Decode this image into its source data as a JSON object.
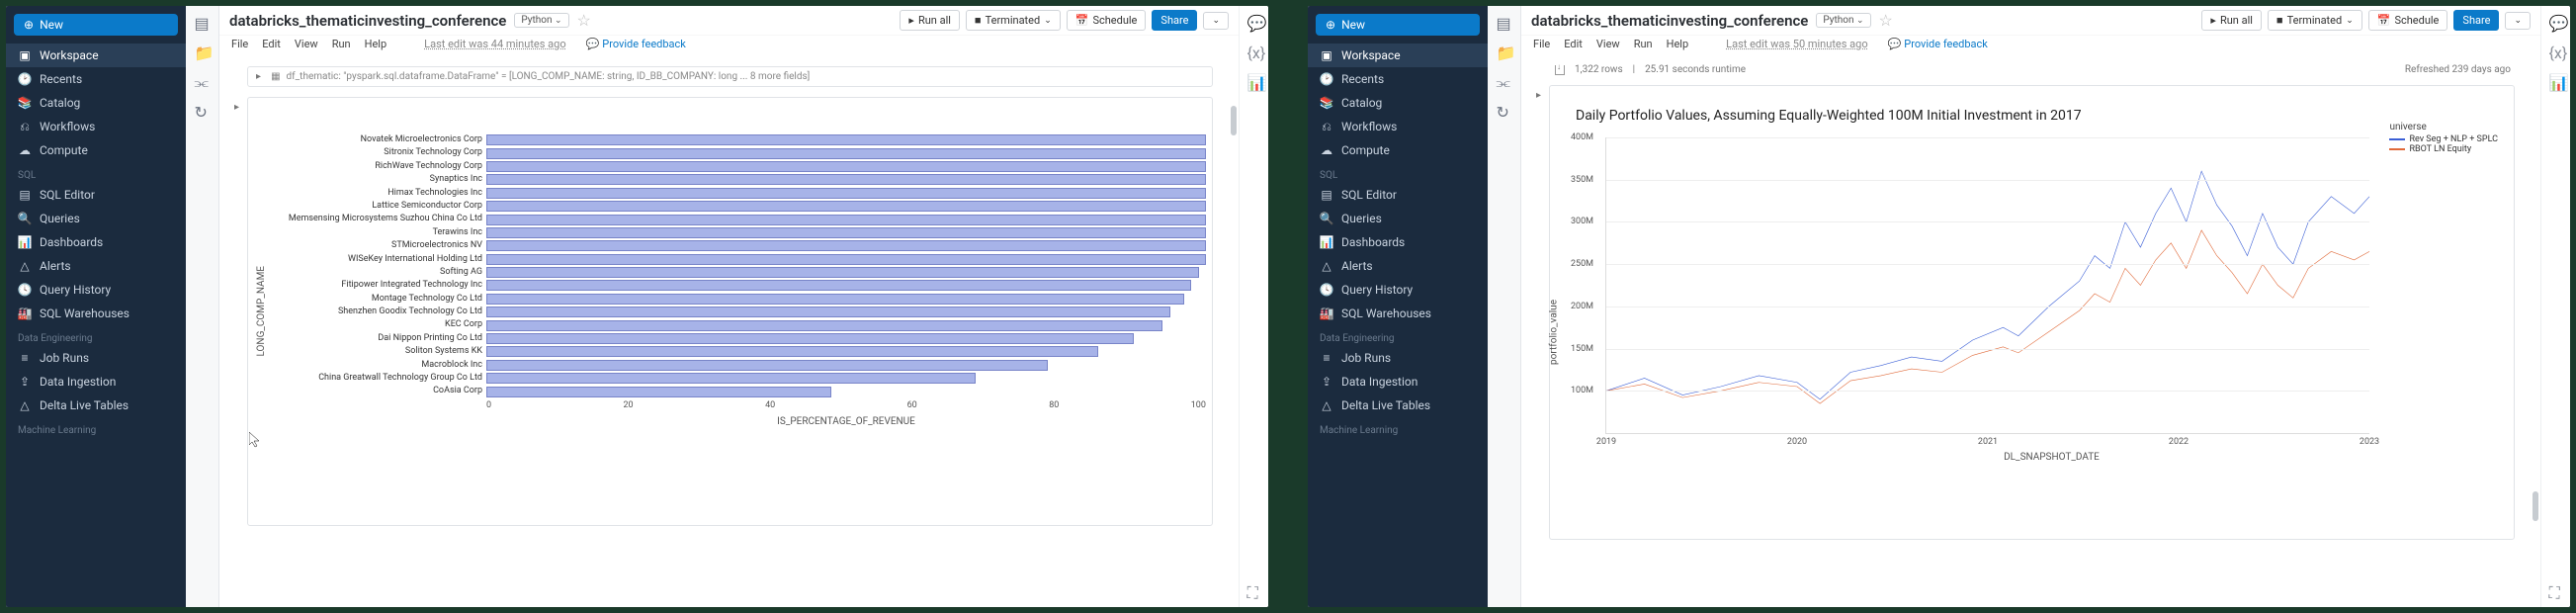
{
  "sidebar": {
    "new_label": "New",
    "items_main": [
      {
        "icon": "workspace",
        "label": "Workspace",
        "active": true
      },
      {
        "icon": "recents",
        "label": "Recents"
      },
      {
        "icon": "catalog",
        "label": "Catalog"
      },
      {
        "icon": "workflows",
        "label": "Workflows"
      },
      {
        "icon": "compute",
        "label": "Compute"
      }
    ],
    "section_sql": "SQL",
    "items_sql": [
      {
        "icon": "sqleditor",
        "label": "SQL Editor"
      },
      {
        "icon": "queries",
        "label": "Queries"
      },
      {
        "icon": "dashboards",
        "label": "Dashboards"
      },
      {
        "icon": "alerts",
        "label": "Alerts"
      },
      {
        "icon": "queryhistory",
        "label": "Query History"
      },
      {
        "icon": "warehouses",
        "label": "SQL Warehouses"
      }
    ],
    "section_de": "Data Engineering",
    "items_de": [
      {
        "icon": "jobruns",
        "label": "Job Runs"
      },
      {
        "icon": "ingestion",
        "label": "Data Ingestion"
      },
      {
        "icon": "dlt",
        "label": "Delta Live Tables"
      }
    ],
    "section_ml": "Machine Learning"
  },
  "notebook_left": {
    "title": "databricks_thematicinvesting_conference",
    "language": "Python",
    "menus": [
      "File",
      "Edit",
      "View",
      "Run",
      "Help"
    ],
    "last_edit": "Last edit was 44 minutes ago",
    "feedback": "Provide feedback",
    "run_all": "Run all",
    "status": "Terminated",
    "schedule": "Schedule",
    "share": "Share",
    "cell_stub": "df_thematic: \"pyspark.sql.dataframe.DataFrame\" = [LONG_COMP_NAME: string, ID_BB_COMPANY: long ... 8 more fields]"
  },
  "notebook_right": {
    "title": "databricks_thematicinvesting_conference",
    "language": "Python",
    "menus": [
      "File",
      "Edit",
      "View",
      "Run",
      "Help"
    ],
    "last_edit": "Last edit was 50 minutes ago",
    "feedback": "Provide feedback",
    "run_all": "Run all",
    "status": "Terminated",
    "schedule": "Schedule",
    "share": "Share",
    "status_rows": "1,322 rows",
    "status_runtime": "25.91 seconds runtime",
    "status_refreshed": "Refreshed 239 days ago"
  },
  "chart_data": [
    {
      "type": "bar",
      "orientation": "horizontal",
      "xlabel": "IS_PERCENTAGE_OF_REVENUE",
      "ylabel": "LONG_COMP_NAME",
      "xlim": [
        0,
        100
      ],
      "xticks": [
        0,
        20,
        40,
        60,
        80,
        100
      ],
      "categories": [
        "Novatek Microelectronics Corp",
        "Sitronix Technology Corp",
        "RichWave Technology Corp",
        "Synaptics Inc",
        "Himax Technologies Inc",
        "Lattice Semiconductor Corp",
        "Memsensing Microsystems Suzhou China Co Ltd",
        "Terawins Inc",
        "STMicroelectronics NV",
        "WISeKey International Holding Ltd",
        "Softing AG",
        "Fitipower Integrated Technology Inc",
        "Montage Technology Co Ltd",
        "Shenzhen Goodix Technology Co Ltd",
        "KEC Corp",
        "Dai Nippon Printing Co Ltd",
        "Soliton Systems KK",
        "Macroblock Inc",
        "China Greatwall Technology Group Co Ltd",
        "CoAsia Corp"
      ],
      "values": [
        100,
        100,
        100,
        100,
        100,
        100,
        100,
        100,
        100,
        100,
        99,
        98,
        97,
        95,
        94,
        90,
        85,
        78,
        68,
        48
      ]
    },
    {
      "type": "line",
      "title": "Daily Portfolio Values, Assuming Equally-Weighted 100M Initial Investment in 2017",
      "xlabel": "DL_SNAPSHOT_DATE",
      "ylabel": "portfolio_value",
      "legend_title": "universe",
      "legend_position": "right",
      "ylim": [
        50000000,
        400000000
      ],
      "yticks_labels": [
        "100M",
        "150M",
        "200M",
        "250M",
        "300M",
        "350M",
        "400M"
      ],
      "yticks_vals": [
        100,
        150,
        200,
        250,
        300,
        350,
        400
      ],
      "x_categories": [
        "2019",
        "2020",
        "2021",
        "2022",
        "2023"
      ],
      "series": [
        {
          "name": "Rev Seg + NLP + SPLC",
          "color": "#3b5fd6",
          "points": [
            [
              0,
              100
            ],
            [
              5,
              115
            ],
            [
              10,
              95
            ],
            [
              15,
              105
            ],
            [
              20,
              118
            ],
            [
              25,
              110
            ],
            [
              28,
              90
            ],
            [
              32,
              122
            ],
            [
              36,
              130
            ],
            [
              40,
              140
            ],
            [
              44,
              135
            ],
            [
              48,
              160
            ],
            [
              52,
              175
            ],
            [
              54,
              165
            ],
            [
              58,
              200
            ],
            [
              62,
              230
            ],
            [
              64,
              260
            ],
            [
              66,
              245
            ],
            [
              68,
              300
            ],
            [
              70,
              270
            ],
            [
              72,
              310
            ],
            [
              74,
              340
            ],
            [
              76,
              300
            ],
            [
              78,
              360
            ],
            [
              80,
              320
            ],
            [
              82,
              295
            ],
            [
              84,
              260
            ],
            [
              86,
              310
            ],
            [
              88,
              270
            ],
            [
              90,
              250
            ],
            [
              92,
              300
            ],
            [
              95,
              330
            ],
            [
              98,
              310
            ],
            [
              100,
              330
            ]
          ]
        },
        {
          "name": "RBOT LN Equity",
          "color": "#e06a3a",
          "points": [
            [
              0,
              100
            ],
            [
              5,
              108
            ],
            [
              10,
              92
            ],
            [
              15,
              100
            ],
            [
              20,
              110
            ],
            [
              25,
              105
            ],
            [
              28,
              85
            ],
            [
              32,
              112
            ],
            [
              36,
              118
            ],
            [
              40,
              126
            ],
            [
              44,
              122
            ],
            [
              48,
              142
            ],
            [
              52,
              152
            ],
            [
              54,
              145
            ],
            [
              58,
              170
            ],
            [
              62,
              195
            ],
            [
              64,
              215
            ],
            [
              66,
              205
            ],
            [
              68,
              245
            ],
            [
              70,
              225
            ],
            [
              72,
              255
            ],
            [
              74,
              275
            ],
            [
              76,
              245
            ],
            [
              78,
              290
            ],
            [
              80,
              260
            ],
            [
              82,
              240
            ],
            [
              84,
              215
            ],
            [
              86,
              250
            ],
            [
              88,
              225
            ],
            [
              90,
              210
            ],
            [
              92,
              245
            ],
            [
              95,
              265
            ],
            [
              98,
              255
            ],
            [
              100,
              265
            ]
          ]
        }
      ]
    }
  ]
}
